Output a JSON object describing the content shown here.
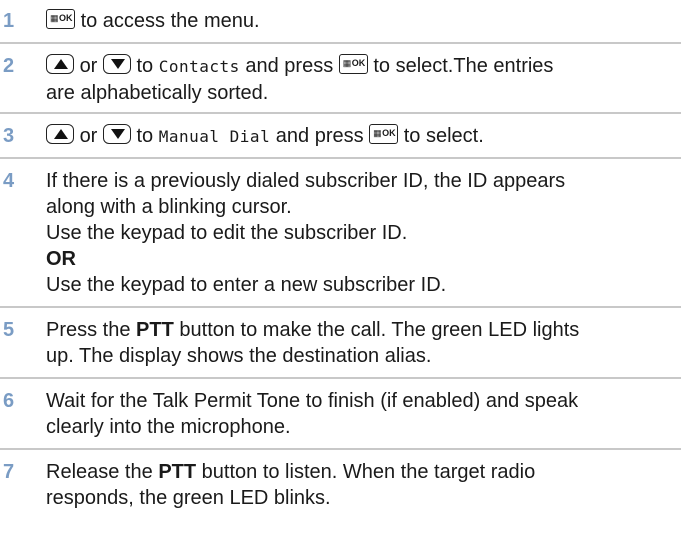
{
  "steps": [
    {
      "num": "1",
      "t1": "to access the menu."
    },
    {
      "num": "2",
      "or": "or",
      "to": "to",
      "menu_item": "Contacts",
      "press": "and press",
      "t2": "to select.The entries",
      "t3": "are alphabetically sorted."
    },
    {
      "num": "3",
      "or": "or",
      "to": "to",
      "menu_item": "Manual Dial",
      "press": "and press",
      "t2": "to select."
    },
    {
      "num": "4",
      "l1": "If there is a previously dialed subscriber ID, the ID appears",
      "l2": "along with a blinking cursor.",
      "l3": "Use the keypad to edit the subscriber ID.",
      "l4": "OR",
      "l5": "Use the keypad to enter a new subscriber ID."
    },
    {
      "num": "5",
      "a": "Press the",
      "b": "PTT",
      "c": "button to make the call. The green LED lights",
      "d": "up. The display shows the destination alias."
    },
    {
      "num": "6",
      "l1": "Wait for the Talk Permit Tone to finish (if enabled) and speak",
      "l2": "clearly into the microphone."
    },
    {
      "num": "7",
      "a": "Release the",
      "b": "PTT",
      "c": "button to listen. When the target radio",
      "d": "responds, the green LED blinks."
    }
  ],
  "icons": {
    "menu_ok": "menu-ok-key-icon",
    "up": "up-arrow-key-icon",
    "down": "down-arrow-key-icon"
  },
  "colors": {
    "step_number": "#7a9cc4",
    "separator": "#c8c8c8"
  }
}
